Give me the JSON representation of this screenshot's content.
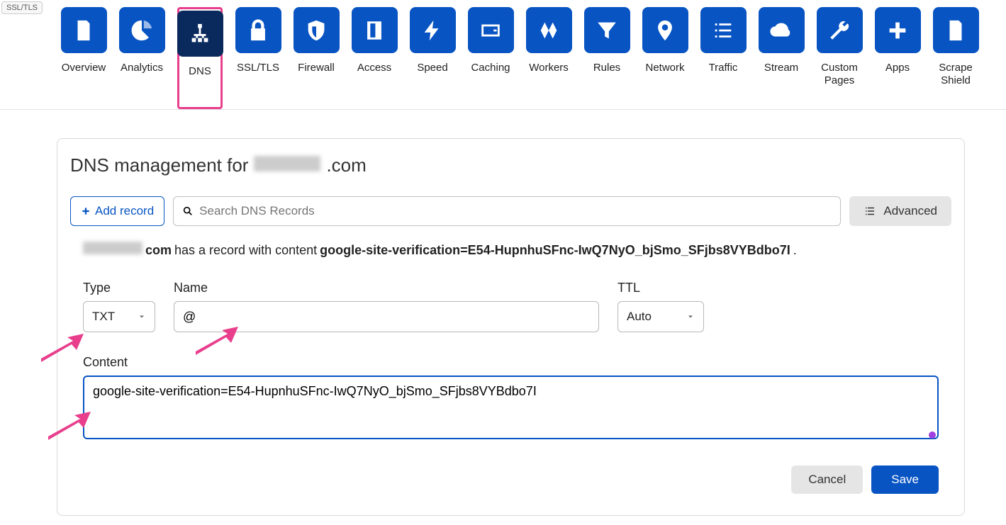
{
  "ssl_badge": "SSL/TLS",
  "nav": [
    {
      "label": "Overview"
    },
    {
      "label": "Analytics"
    },
    {
      "label": "DNS",
      "active": true
    },
    {
      "label": "SSL/TLS"
    },
    {
      "label": "Firewall"
    },
    {
      "label": "Access"
    },
    {
      "label": "Speed"
    },
    {
      "label": "Caching"
    },
    {
      "label": "Workers"
    },
    {
      "label": "Rules"
    },
    {
      "label": "Network"
    },
    {
      "label": "Traffic"
    },
    {
      "label": "Stream"
    },
    {
      "label": "Custom Pages"
    },
    {
      "label": "Apps"
    },
    {
      "label": "Scrape Shield"
    }
  ],
  "panel": {
    "title_prefix": "DNS management for",
    "domain_suffix": ".com"
  },
  "toolbar": {
    "add_record_label": "Add record",
    "search_placeholder": "Search DNS Records",
    "advanced_label": "Advanced"
  },
  "notice": {
    "domain_suffix": "com",
    "has_record_text": "has a record with content",
    "record_value": "google-site-verification=E54-HupnhuSFnc-IwQ7NyO_bjSmo_SFjbs8VYBdbo7I",
    "period": "."
  },
  "form": {
    "type_label": "Type",
    "type_value": "TXT",
    "name_label": "Name",
    "name_value": "@",
    "ttl_label": "TTL",
    "ttl_value": "Auto",
    "content_label": "Content",
    "content_value": "google-site-verification=E54-HupnhuSFnc-IwQ7NyO_bjSmo_SFjbs8VYBdbo7I"
  },
  "actions": {
    "cancel_label": "Cancel",
    "save_label": "Save"
  }
}
